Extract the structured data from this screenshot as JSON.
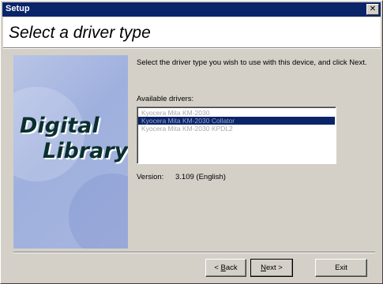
{
  "window": {
    "title": "Setup"
  },
  "header": {
    "title": "Select a driver type"
  },
  "brand": {
    "line1": "Digital",
    "line2": "Library"
  },
  "content": {
    "instructions": "Select the driver type you wish to use with this device, and click Next.",
    "available_label": "Available drivers:",
    "drivers": [
      {
        "label": "Kyocera Mita KM-2030",
        "selected": false
      },
      {
        "label": "Kyocera Mita KM-2030 Collator",
        "selected": true
      },
      {
        "label": "Kyocera Mita KM-2030 KPDL2",
        "selected": false
      }
    ],
    "version_label": "Version:",
    "version_value": "3.109 (English)"
  },
  "buttons": {
    "back_prefix": "< ",
    "back_accel": "B",
    "back_rest": "ack",
    "next_accel": "N",
    "next_rest": "ext >",
    "exit": "Exit"
  },
  "icons": {
    "close": "close-icon"
  },
  "colors": {
    "titlebar": "#0a246a",
    "face": "#d4d0c8",
    "selection": "#0a246a"
  }
}
